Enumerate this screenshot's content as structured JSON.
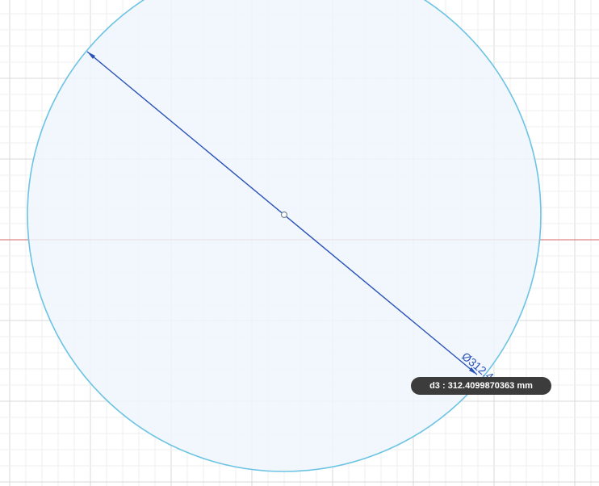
{
  "sketch": {
    "dimension_label": "Ø312.4",
    "tooltip": "d3 : 312.4099870363 mm",
    "colors": {
      "background": "#ffffff",
      "grid_minor": "#efefef",
      "grid_major": "#d9d9d9",
      "axis": "#d46a6a",
      "profile_fill": "#eef6fc",
      "circle_stroke": "#6cc3e3",
      "dimension": "#2a52b8",
      "tooltip_bg": "#3c3c3c"
    }
  }
}
